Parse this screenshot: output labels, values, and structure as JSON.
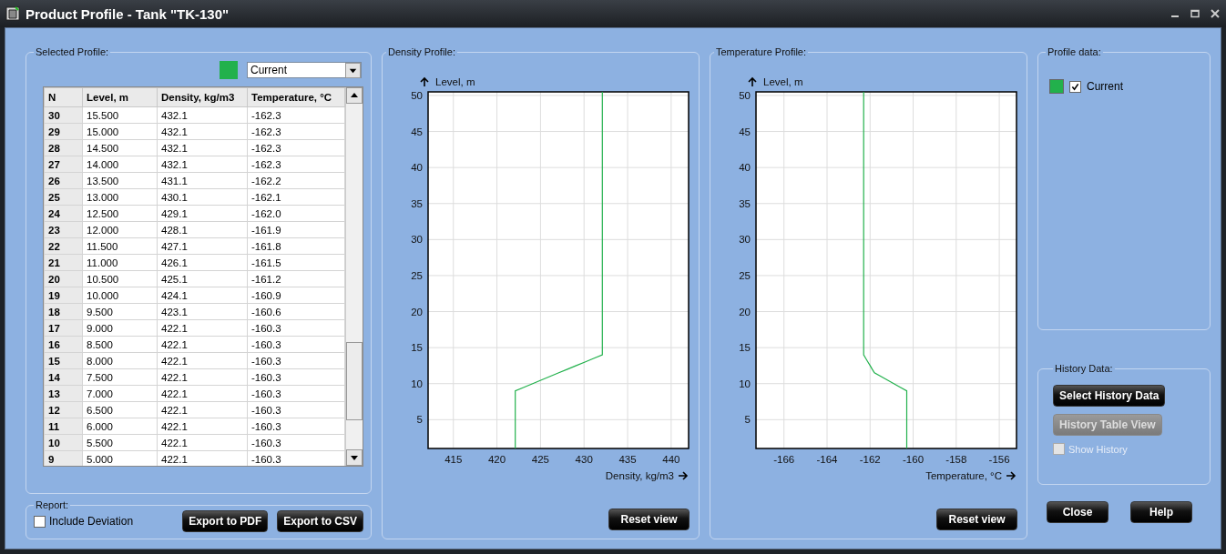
{
  "window": {
    "title": "Product Profile - Tank \"TK-130\""
  },
  "selected_profile": {
    "title": "Selected Profile:",
    "color": "#22b14c",
    "dropdown": {
      "value": "Current"
    },
    "table": {
      "columns": [
        "N",
        "Level, m",
        "Density, kg/m3",
        "Temperature, °C"
      ],
      "rows": [
        [
          "30",
          "15.500",
          "432.1",
          "-162.3"
        ],
        [
          "29",
          "15.000",
          "432.1",
          "-162.3"
        ],
        [
          "28",
          "14.500",
          "432.1",
          "-162.3"
        ],
        [
          "27",
          "14.000",
          "432.1",
          "-162.3"
        ],
        [
          "26",
          "13.500",
          "431.1",
          "-162.2"
        ],
        [
          "25",
          "13.000",
          "430.1",
          "-162.1"
        ],
        [
          "24",
          "12.500",
          "429.1",
          "-162.0"
        ],
        [
          "23",
          "12.000",
          "428.1",
          "-161.9"
        ],
        [
          "22",
          "11.500",
          "427.1",
          "-161.8"
        ],
        [
          "21",
          "11.000",
          "426.1",
          "-161.5"
        ],
        [
          "20",
          "10.500",
          "425.1",
          "-161.2"
        ],
        [
          "19",
          "10.000",
          "424.1",
          "-160.9"
        ],
        [
          "18",
          "9.500",
          "423.1",
          "-160.6"
        ],
        [
          "17",
          "9.000",
          "422.1",
          "-160.3"
        ],
        [
          "16",
          "8.500",
          "422.1",
          "-160.3"
        ],
        [
          "15",
          "8.000",
          "422.1",
          "-160.3"
        ],
        [
          "14",
          "7.500",
          "422.1",
          "-160.3"
        ],
        [
          "13",
          "7.000",
          "422.1",
          "-160.3"
        ],
        [
          "12",
          "6.500",
          "422.1",
          "-160.3"
        ],
        [
          "11",
          "6.000",
          "422.1",
          "-160.3"
        ],
        [
          "10",
          "5.500",
          "422.1",
          "-160.3"
        ],
        [
          "9",
          "5.000",
          "422.1",
          "-160.3"
        ]
      ]
    }
  },
  "report": {
    "title": "Report:",
    "include_deviation": {
      "label": "Include Deviation",
      "checked": false
    },
    "buttons": [
      "Export to PDF",
      "Export to CSV"
    ]
  },
  "density_profile": {
    "title": "Density Profile:",
    "reset_button": "Reset view",
    "chart_data": {
      "type": "line",
      "xlabel": "Density, kg/m3",
      "ylabel": "Level, m",
      "x": [
        422.1,
        422.1,
        423.1,
        424.1,
        425.1,
        426.1,
        427.1,
        428.1,
        429.1,
        430.1,
        431.1,
        432.1,
        432.1
      ],
      "series": [
        {
          "color": "#22b14c",
          "values": [
            1,
            9,
            9.5,
            10,
            10.5,
            11,
            11.5,
            12,
            12.5,
            13,
            13.5,
            14,
            50.5
          ]
        }
      ],
      "grid": true,
      "xlim": [
        412.1,
        442
      ],
      "ylim": [
        1,
        50.5
      ],
      "xticks": [
        415,
        420,
        425,
        430,
        435,
        440
      ],
      "yticks": [
        5,
        10,
        15,
        20,
        25,
        30,
        35,
        40,
        45,
        50
      ]
    }
  },
  "temperature_profile": {
    "title": "Temperature Profile:",
    "reset_button": "Reset view",
    "chart_data": {
      "type": "line",
      "xlabel": "Temperature, °C",
      "ylabel": "Level, m",
      "x": [
        -160.3,
        -160.3,
        -160.6,
        -160.9,
        -161.2,
        -161.5,
        -161.8,
        -161.9,
        -162.0,
        -162.1,
        -162.2,
        -162.3,
        -162.3
      ],
      "series": [
        {
          "color": "#22b14c",
          "values": [
            1,
            9,
            9.5,
            10,
            10.5,
            11,
            11.5,
            12,
            12.5,
            13,
            13.5,
            14,
            50.5
          ]
        }
      ],
      "grid": true,
      "xlim": [
        -167.3,
        -155.2
      ],
      "ylim": [
        1,
        50.5
      ],
      "xticks": [
        -166,
        -164,
        -162,
        -160,
        -158,
        -156
      ],
      "yticks": [
        5,
        10,
        15,
        20,
        25,
        30,
        35,
        40,
        45,
        50
      ]
    }
  },
  "profile_data": {
    "title": "Profile data:",
    "items": [
      {
        "label": "Current",
        "color": "#22b14c",
        "checked": true
      }
    ]
  },
  "history_data": {
    "title": "History Data:",
    "select_button": {
      "label": "Select History Data",
      "disabled": false
    },
    "table_view_button": {
      "label": "History Table View",
      "disabled": true
    },
    "show_history": {
      "label": "Show History",
      "checked": false,
      "disabled": true
    }
  },
  "buttons": [
    "Close",
    "Help"
  ]
}
